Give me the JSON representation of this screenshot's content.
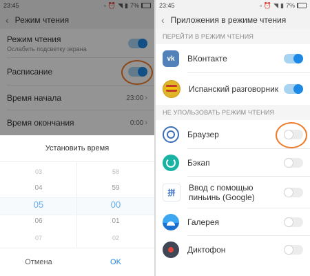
{
  "status_left": {
    "time": "23:45",
    "battery": "7%"
  },
  "status_right": {
    "time": "23:45",
    "battery": "7%"
  },
  "left": {
    "header_title": "Режим чтения",
    "reading_mode": {
      "title": "Режим чтения",
      "subtitle": "Ослабить подсветку экрана",
      "enabled": true
    },
    "schedule": {
      "title": "Расписание",
      "enabled": true
    },
    "start_time": {
      "title": "Время начала",
      "value": "23:00"
    },
    "end_time": {
      "title": "Время окончания",
      "value": "0:00"
    },
    "dialog": {
      "title": "Установить время",
      "hours": [
        "03",
        "04",
        "05",
        "06",
        "07"
      ],
      "minutes": [
        "58",
        "59",
        "00",
        "01",
        "02"
      ],
      "cancel": "Отмена",
      "ok": "OK"
    }
  },
  "right": {
    "header_title": "Приложения в режиме чтения",
    "section_on": "ПЕРЕЙТИ В РЕЖИМ ЧТЕНИЯ",
    "section_off": "НЕ УПОЛЬЗОВАТЬ РЕЖИМ ЧТЕНИЯ",
    "apps_on": [
      {
        "name": "ВКонтакте",
        "icon": "vk-icon",
        "enabled": true
      },
      {
        "name": "Испанский разговорник",
        "icon": "spanish-phrasebook-icon",
        "enabled": true
      }
    ],
    "apps_off": [
      {
        "name": "Браузер",
        "icon": "browser-icon",
        "enabled": false
      },
      {
        "name": "Бэкап",
        "icon": "backup-icon",
        "enabled": false
      },
      {
        "name": "Ввод с помощью пиньинь (Google)",
        "icon": "pinyin-input-icon",
        "enabled": false
      },
      {
        "name": "Галерея",
        "icon": "gallery-icon",
        "enabled": false
      },
      {
        "name": "Диктофон",
        "icon": "recorder-icon",
        "enabled": false
      }
    ]
  },
  "colors": {
    "accent": "#1e88e5",
    "highlight_ring": "#f07a2a"
  }
}
